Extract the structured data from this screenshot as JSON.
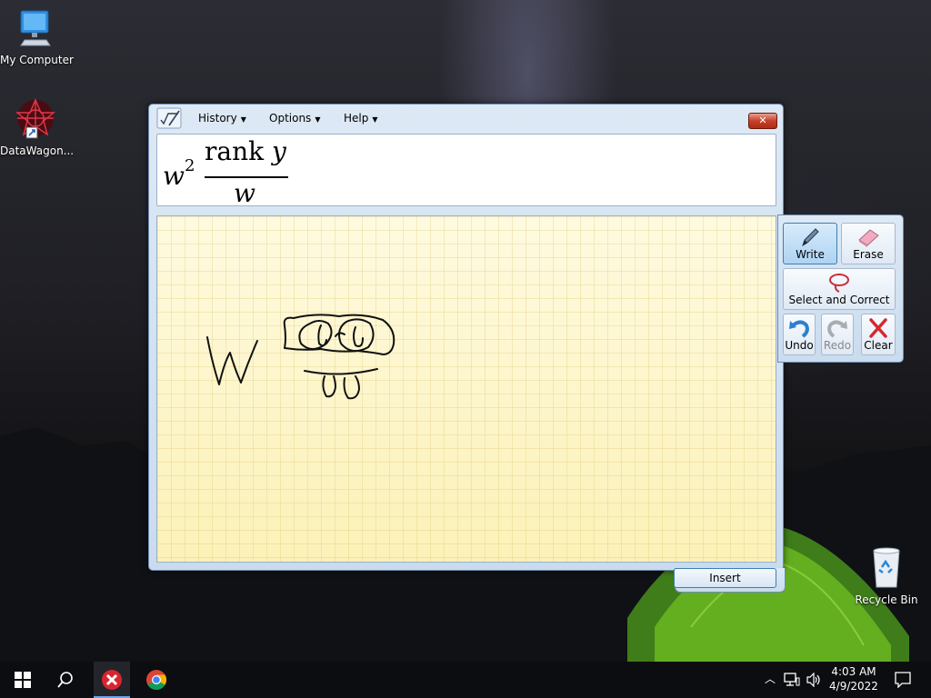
{
  "desktop": {
    "icons": [
      {
        "label": "My Computer"
      },
      {
        "label": "DataWagon..."
      },
      {
        "label": "Recycle Bin"
      }
    ]
  },
  "window": {
    "menus": [
      {
        "label": "History"
      },
      {
        "label": "Options"
      },
      {
        "label": "Help"
      }
    ],
    "close_label": "✕",
    "preview": {
      "base": "w",
      "exponent": "2",
      "numerator_word": "rank",
      "numerator_var": "y",
      "denominator": "w"
    },
    "insert_label": "Insert"
  },
  "tools": {
    "write": "Write",
    "erase": "Erase",
    "select_correct": "Select and Correct",
    "undo": "Undo",
    "redo": "Redo",
    "clear": "Clear"
  },
  "taskbar": {
    "time": "4:03 AM",
    "date": "4/9/2022"
  },
  "colors": {
    "accent": "#3c7fb1",
    "canvas": "#fdf6c6",
    "close": "#c6412a"
  }
}
